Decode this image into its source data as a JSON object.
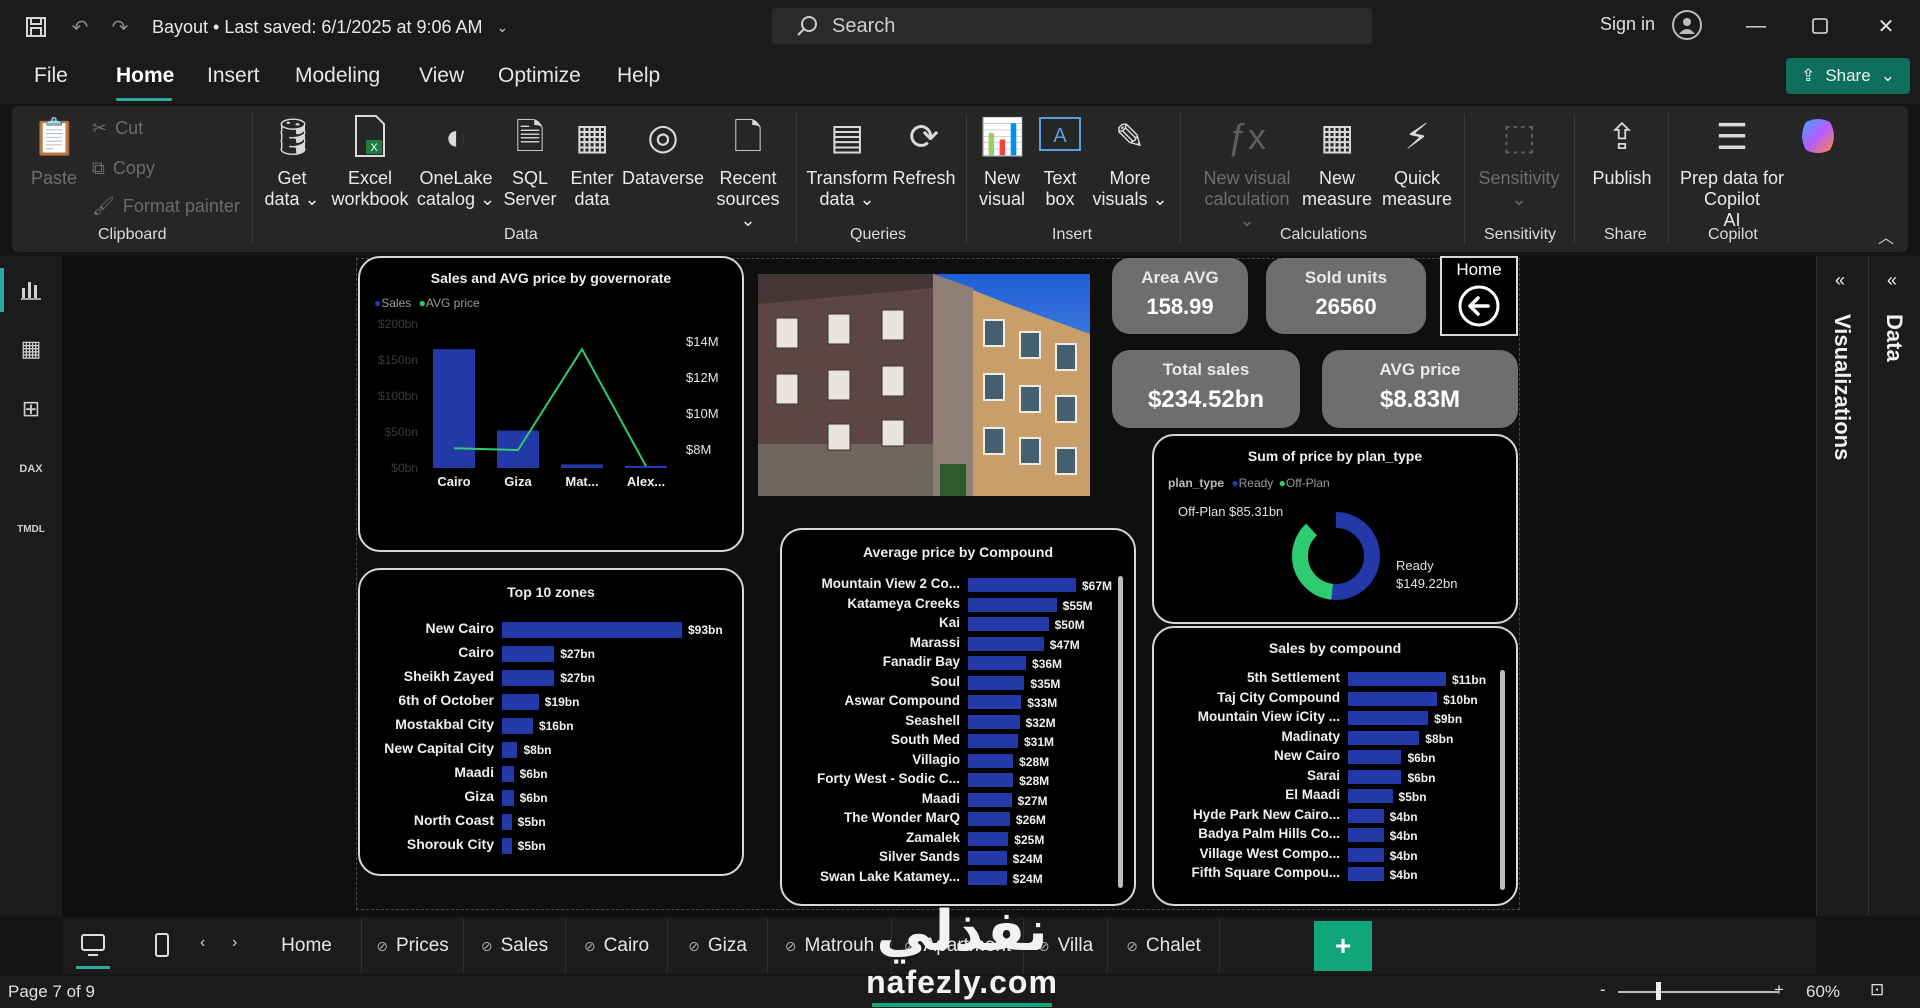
{
  "titlebar": {
    "doc_title": "Bayout • Last saved: 6/1/2025 at 9:06 AM",
    "search_placeholder": "Search",
    "sign_in": "Sign in"
  },
  "menu": {
    "items": [
      "File",
      "Home",
      "Insert",
      "Modeling",
      "View",
      "Optimize",
      "Help"
    ],
    "active": "Home",
    "share_label": "Share"
  },
  "ribbon": {
    "clipboard": {
      "paste": "Paste",
      "cut": "Cut",
      "copy": "Copy",
      "format_painter": "Format painter",
      "label": "Clipboard"
    },
    "data": {
      "get_data": [
        "Get",
        "data ⌄"
      ],
      "excel": [
        "Excel",
        "workbook"
      ],
      "onelake": [
        "OneLake",
        "catalog ⌄"
      ],
      "sql": [
        "SQL",
        "Server"
      ],
      "enter": [
        "Enter",
        "data"
      ],
      "dataverse": [
        "Dataverse",
        ""
      ],
      "recent": [
        "Recent",
        "sources ⌄"
      ],
      "label": "Data"
    },
    "queries": {
      "transform": [
        "Transform",
        "data ⌄"
      ],
      "refresh": [
        "Refresh",
        ""
      ],
      "label": "Queries"
    },
    "insert": {
      "new_visual": [
        "New",
        "visual"
      ],
      "text_box": [
        "Text",
        "box"
      ],
      "more_visuals": [
        "More",
        "visuals ⌄"
      ],
      "label": "Insert"
    },
    "calculations": {
      "new_visual_calc": [
        "New visual",
        "calculation ⌄"
      ],
      "new_measure": [
        "New",
        "measure"
      ],
      "quick_measure": [
        "Quick",
        "measure"
      ],
      "label": "Calculations"
    },
    "sensitivity": {
      "button": [
        "Sensitivity",
        "⌄"
      ],
      "label": "Sensitivity"
    },
    "share": {
      "publish": [
        "Publish",
        ""
      ],
      "label": "Share"
    },
    "copilot": {
      "prep": [
        "Prep data for Copilot",
        "AI"
      ],
      "label": "Copilot"
    }
  },
  "kpis": {
    "area_avg": {
      "label": "Area AVG",
      "value": "158.99"
    },
    "sold_units": {
      "label": "Sold units",
      "value": "26560"
    },
    "total_sales": {
      "label": "Total sales",
      "value": "$234.52bn"
    },
    "avg_price": {
      "label": "AVG price",
      "value": "$8.83M"
    },
    "home_label": "Home"
  },
  "charts": {
    "governorate": {
      "title": "Sales and AVG price by governorate",
      "legend": [
        "Sales",
        "AVG price"
      ]
    },
    "top_zones": {
      "title": "Top 10 zones"
    },
    "compound_avg": {
      "title": "Average price by Compound"
    },
    "plan_type": {
      "title": "Sum of  price  by plan_type",
      "legend_title": "plan_type",
      "legend": [
        "Ready",
        "Off-Plan"
      ],
      "label_offplan": "Off-Plan $85.31bn",
      "label_ready_1": "Ready",
      "label_ready_2": "$149.22bn"
    },
    "sales_compound": {
      "title": "Sales by compound"
    }
  },
  "chart_data": [
    {
      "type": "bar",
      "title": "Sales and AVG price by governorate",
      "categories": [
        "Cairo",
        "Giza",
        "Mat...",
        "Alex..."
      ],
      "series": [
        {
          "name": "Sales",
          "type": "bar",
          "values": [
            165,
            52,
            5,
            3
          ],
          "unit": "bn"
        },
        {
          "name": "AVG price",
          "type": "line",
          "values": [
            8.1,
            8.0,
            13.6,
            7.1
          ],
          "unit": "M"
        }
      ],
      "y_left_ticks": [
        "$0bn",
        "$50bn",
        "$100bn",
        "$150bn",
        "$200bn"
      ],
      "y_right_ticks": [
        "$8M",
        "$10M",
        "$12M",
        "$14M"
      ],
      "ylim_left": [
        0,
        200
      ],
      "ylim_right": [
        7,
        15
      ]
    },
    {
      "type": "bar",
      "title": "Top 10 zones",
      "categories": [
        "New Cairo",
        "Cairo",
        "Sheikh Zayed",
        "6th of October",
        "Mostakbal City",
        "New Capital City",
        "Maadi",
        "Giza",
        "North Coast",
        "Shorouk City"
      ],
      "values": [
        93,
        27,
        27,
        19,
        16,
        8,
        6,
        6,
        5,
        5
      ],
      "labels": [
        "$93bn",
        "$27bn",
        "$27bn",
        "$19bn",
        "$16bn",
        "$8bn",
        "$6bn",
        "$6bn",
        "$5bn",
        "$5bn"
      ]
    },
    {
      "type": "bar",
      "title": "Average price by Compound",
      "categories": [
        "Mountain View 2 Co...",
        "Katameya Creeks",
        "Kai",
        "Marassi",
        "Fanadir Bay",
        "Soul",
        "Aswar Compound",
        "Seashell",
        "South Med",
        "Villagio",
        "Forty West - Sodic C...",
        "Maadi",
        "The Wonder MarQ",
        "Zamalek",
        "Silver Sands",
        "Swan Lake Katamey..."
      ],
      "values": [
        67,
        55,
        50,
        47,
        36,
        35,
        33,
        32,
        31,
        28,
        28,
        27,
        26,
        25,
        24,
        24
      ],
      "labels": [
        "$67M",
        "$55M",
        "$50M",
        "$47M",
        "$36M",
        "$35M",
        "$33M",
        "$32M",
        "$31M",
        "$28M",
        "$28M",
        "$27M",
        "$26M",
        "$25M",
        "$24M",
        "$24M"
      ]
    },
    {
      "type": "pie",
      "title": "Sum of  price  by plan_type",
      "categories": [
        "Ready",
        "Off-Plan"
      ],
      "values": [
        149.22,
        85.31
      ],
      "colors": [
        "#2339a8",
        "#2ecc71"
      ]
    },
    {
      "type": "bar",
      "title": "Sales by compound",
      "categories": [
        "5th Settlement",
        "Taj City Compound",
        "Mountain View iCity ...",
        "Madinaty",
        "New Cairo",
        "Sarai",
        "El Maadi",
        "Hyde Park New Cairo...",
        "Badya Palm Hills Co...",
        "Village West Compo...",
        "Fifth Square Compou..."
      ],
      "values": [
        11,
        10,
        9,
        8,
        6,
        6,
        5,
        4,
        4,
        4,
        4
      ],
      "labels": [
        "$11bn",
        "$10bn",
        "$9bn",
        "$8bn",
        "$6bn",
        "$6bn",
        "$5bn",
        "$4bn",
        "$4bn",
        "$4bn",
        "$4bn"
      ]
    }
  ],
  "panes": {
    "visualizations": "Visualizations",
    "data": "Data"
  },
  "pages": {
    "tabs": [
      "Home",
      "Prices",
      "Sales",
      "Cairo",
      "Giza",
      "Matrouh",
      "Apartment",
      "Villa",
      "Chalet"
    ],
    "add": "+"
  },
  "status": {
    "page": "Page 7 of 9",
    "zoom": "60%"
  },
  "watermark": {
    "arabic": "نفذلي",
    "latin": "nafezly.com"
  },
  "colors": {
    "accent": "#2fa8a0",
    "bar": "#2339a8",
    "line": "#2ecc71",
    "kpi_bg": "#6e6e6e"
  }
}
